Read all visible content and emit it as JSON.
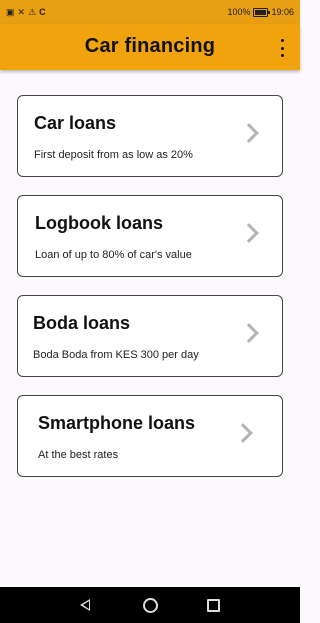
{
  "status_bar": {
    "icons_left": [
      "notification-icon",
      "wifi-off-icon",
      "warning-icon",
      "app-c-icon"
    ],
    "app_letter": "C",
    "battery": "100%",
    "time": "19:06"
  },
  "app_bar": {
    "title": "Car financing",
    "menu_icon": "more-vert-icon",
    "color": "#f0a30c"
  },
  "cards": [
    {
      "title": "Car loans",
      "subtitle": "First deposit from as low as 20%",
      "icon": "chevron-right-icon"
    },
    {
      "title": "Logbook loans",
      "subtitle": "Loan of up to 80% of car's value",
      "icon": "chevron-right-icon"
    },
    {
      "title": "Boda loans",
      "subtitle": "Boda Boda from KES 300 per day",
      "icon": "chevron-right-icon"
    },
    {
      "title": "Smartphone loans",
      "subtitle": "At the best rates",
      "icon": "chevron-right-icon"
    }
  ],
  "nav_bar": {
    "icons": [
      "back-icon",
      "home-icon",
      "recents-icon"
    ]
  }
}
